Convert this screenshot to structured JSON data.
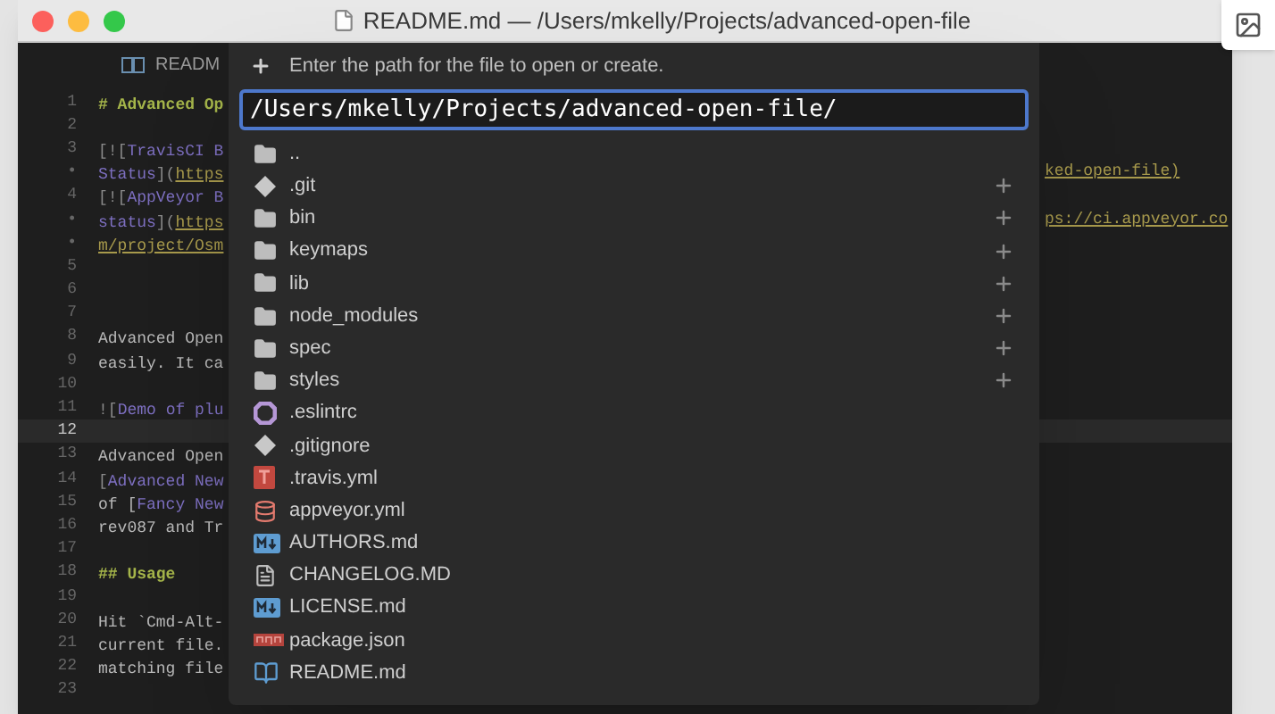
{
  "window": {
    "title": "README.md — /Users/mkelly/Projects/advanced-open-file"
  },
  "tab": {
    "label": "READM"
  },
  "editor": {
    "lines": [
      {
        "number": "1",
        "segments": [
          {
            "text": "# Advanced Op",
            "kind": "heading"
          }
        ]
      },
      {
        "number": "2"
      },
      {
        "number": "3",
        "segments": [
          {
            "text": "[![",
            "kind": "punct"
          },
          {
            "text": "TravisCI B",
            "kind": "link"
          }
        ]
      },
      {
        "number": "•",
        "segments": [
          {
            "text": "Status",
            "kind": "link"
          },
          {
            "text": "](",
            "kind": "punct"
          },
          {
            "text": "https",
            "kind": "url"
          }
        ],
        "right": "ked-open-file)"
      },
      {
        "number": "4",
        "segments": [
          {
            "text": "[![",
            "kind": "punct"
          },
          {
            "text": "AppVeyor B",
            "kind": "link"
          }
        ]
      },
      {
        "number": "•",
        "segments": [
          {
            "text": "status",
            "kind": "link"
          },
          {
            "text": "](",
            "kind": "punct"
          },
          {
            "text": "https",
            "kind": "url"
          }
        ],
        "right": "ps://ci.appveyor.co"
      },
      {
        "number": "•",
        "segments": [
          {
            "text": "m/project/Osm",
            "kind": "url"
          }
        ]
      },
      {
        "number": "5"
      },
      {
        "number": "6"
      },
      {
        "number": "7"
      },
      {
        "number": "8",
        "segments": [
          {
            "text": "Advanced Open",
            "kind": "plain"
          }
        ]
      },
      {
        "number": "9",
        "segments": [
          {
            "text": "easily. It ca",
            "kind": "plain"
          }
        ]
      },
      {
        "number": "10"
      },
      {
        "number": "11",
        "segments": [
          {
            "text": "![",
            "kind": "punct"
          },
          {
            "text": "Demo of plu",
            "kind": "link"
          }
        ]
      },
      {
        "number": "12",
        "current": true
      },
      {
        "number": "13",
        "segments": [
          {
            "text": "Advanced Open",
            "kind": "plain"
          }
        ]
      },
      {
        "number": "14",
        "segments": [
          {
            "text": "[",
            "kind": "punct"
          },
          {
            "text": "Advanced New",
            "kind": "link"
          }
        ]
      },
      {
        "number": "15",
        "segments": [
          {
            "text": "of [",
            "kind": "plain"
          },
          {
            "text": "Fancy New",
            "kind": "link"
          }
        ]
      },
      {
        "number": "16",
        "segments": [
          {
            "text": "rev087 and Tr",
            "kind": "plain"
          }
        ]
      },
      {
        "number": "17"
      },
      {
        "number": "18",
        "segments": [
          {
            "text": "## Usage",
            "kind": "heading"
          }
        ]
      },
      {
        "number": "19"
      },
      {
        "number": "20",
        "segments": [
          {
            "text": "Hit `Cmd-Alt-",
            "kind": "plain"
          }
        ]
      },
      {
        "number": "21",
        "segments": [
          {
            "text": "current file.",
            "kind": "plain"
          }
        ]
      },
      {
        "number": "22",
        "segments": [
          {
            "text": "matching file",
            "kind": "plain"
          }
        ]
      },
      {
        "number": "23"
      }
    ]
  },
  "dialog": {
    "prompt": "Enter the path for the file to open or create.",
    "value": "/Users/mkelly/Projects/advanced-open-file/",
    "items": [
      {
        "name": "..",
        "kind": "folder",
        "addable": false
      },
      {
        "name": ".git",
        "kind": "git",
        "addable": true
      },
      {
        "name": "bin",
        "kind": "folder",
        "addable": true
      },
      {
        "name": "keymaps",
        "kind": "folder",
        "addable": true
      },
      {
        "name": "lib",
        "kind": "folder",
        "addable": true
      },
      {
        "name": "node_modules",
        "kind": "folder",
        "addable": true
      },
      {
        "name": "spec",
        "kind": "folder",
        "addable": true
      },
      {
        "name": "styles",
        "kind": "folder",
        "addable": true
      },
      {
        "name": ".eslintrc",
        "kind": "eslint",
        "addable": false
      },
      {
        "name": ".gitignore",
        "kind": "git",
        "addable": false
      },
      {
        "name": ".travis.yml",
        "kind": "travis",
        "addable": false
      },
      {
        "name": "appveyor.yml",
        "kind": "database",
        "addable": false
      },
      {
        "name": "AUTHORS.md",
        "kind": "markdown",
        "addable": false
      },
      {
        "name": "CHANGELOG.MD",
        "kind": "text",
        "addable": false
      },
      {
        "name": "LICENSE.md",
        "kind": "markdown",
        "addable": false
      },
      {
        "name": "package.json",
        "kind": "npm",
        "addable": false
      },
      {
        "name": "README.md",
        "kind": "book",
        "addable": false
      }
    ]
  }
}
